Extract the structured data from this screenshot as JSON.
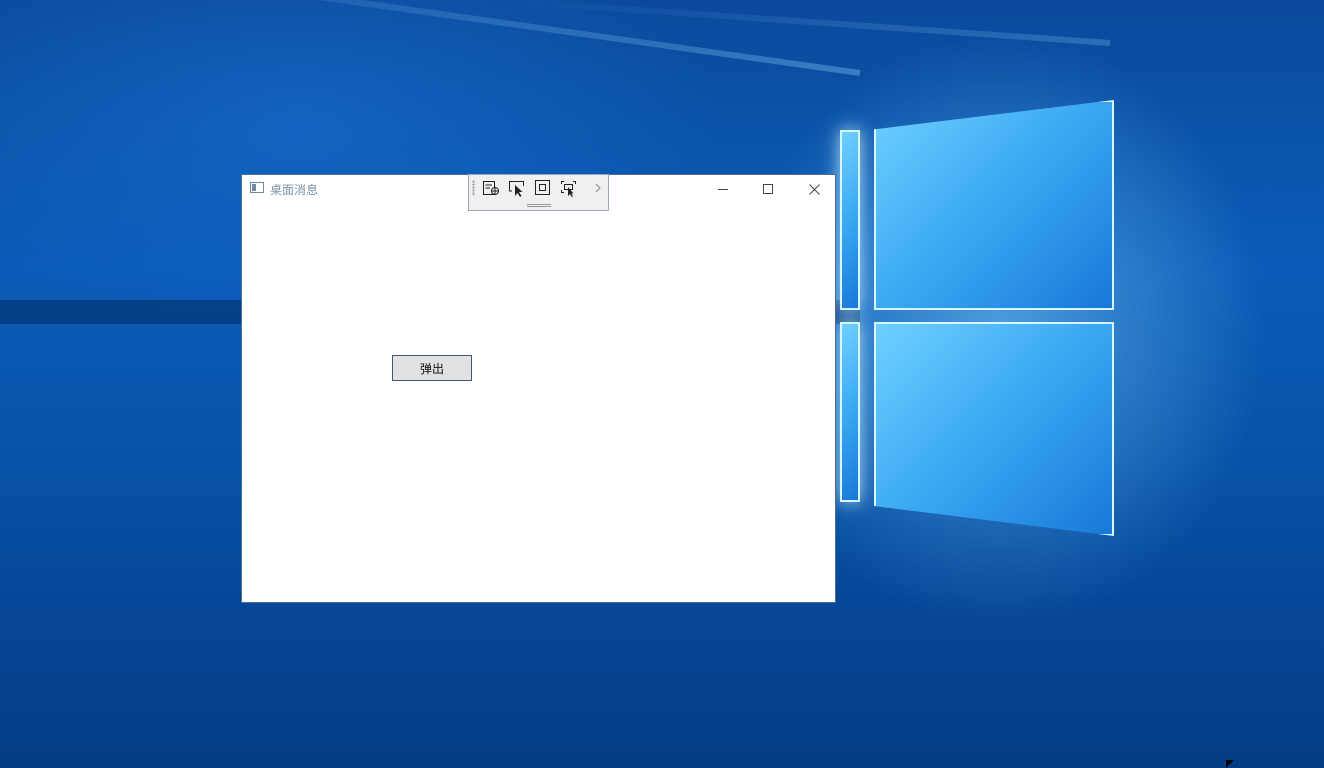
{
  "window": {
    "title": "桌面消息",
    "minimize_icon": "minimize-icon",
    "maximize_icon": "maximize-icon",
    "close_icon": "close-icon"
  },
  "debug_toolbar": {
    "items": [
      {
        "icon": "live-visual-tree-icon"
      },
      {
        "icon": "select-element-icon"
      },
      {
        "icon": "display-layout-adorners-icon"
      },
      {
        "icon": "track-focused-element-icon"
      },
      {
        "icon": "chevron-right-icon"
      }
    ]
  },
  "content": {
    "popup_button_label": "弹出"
  },
  "colors": {
    "desktop_blue": "#0a5cb8",
    "window_border": "#4a6f96",
    "button_face": "#e1e1e1"
  }
}
